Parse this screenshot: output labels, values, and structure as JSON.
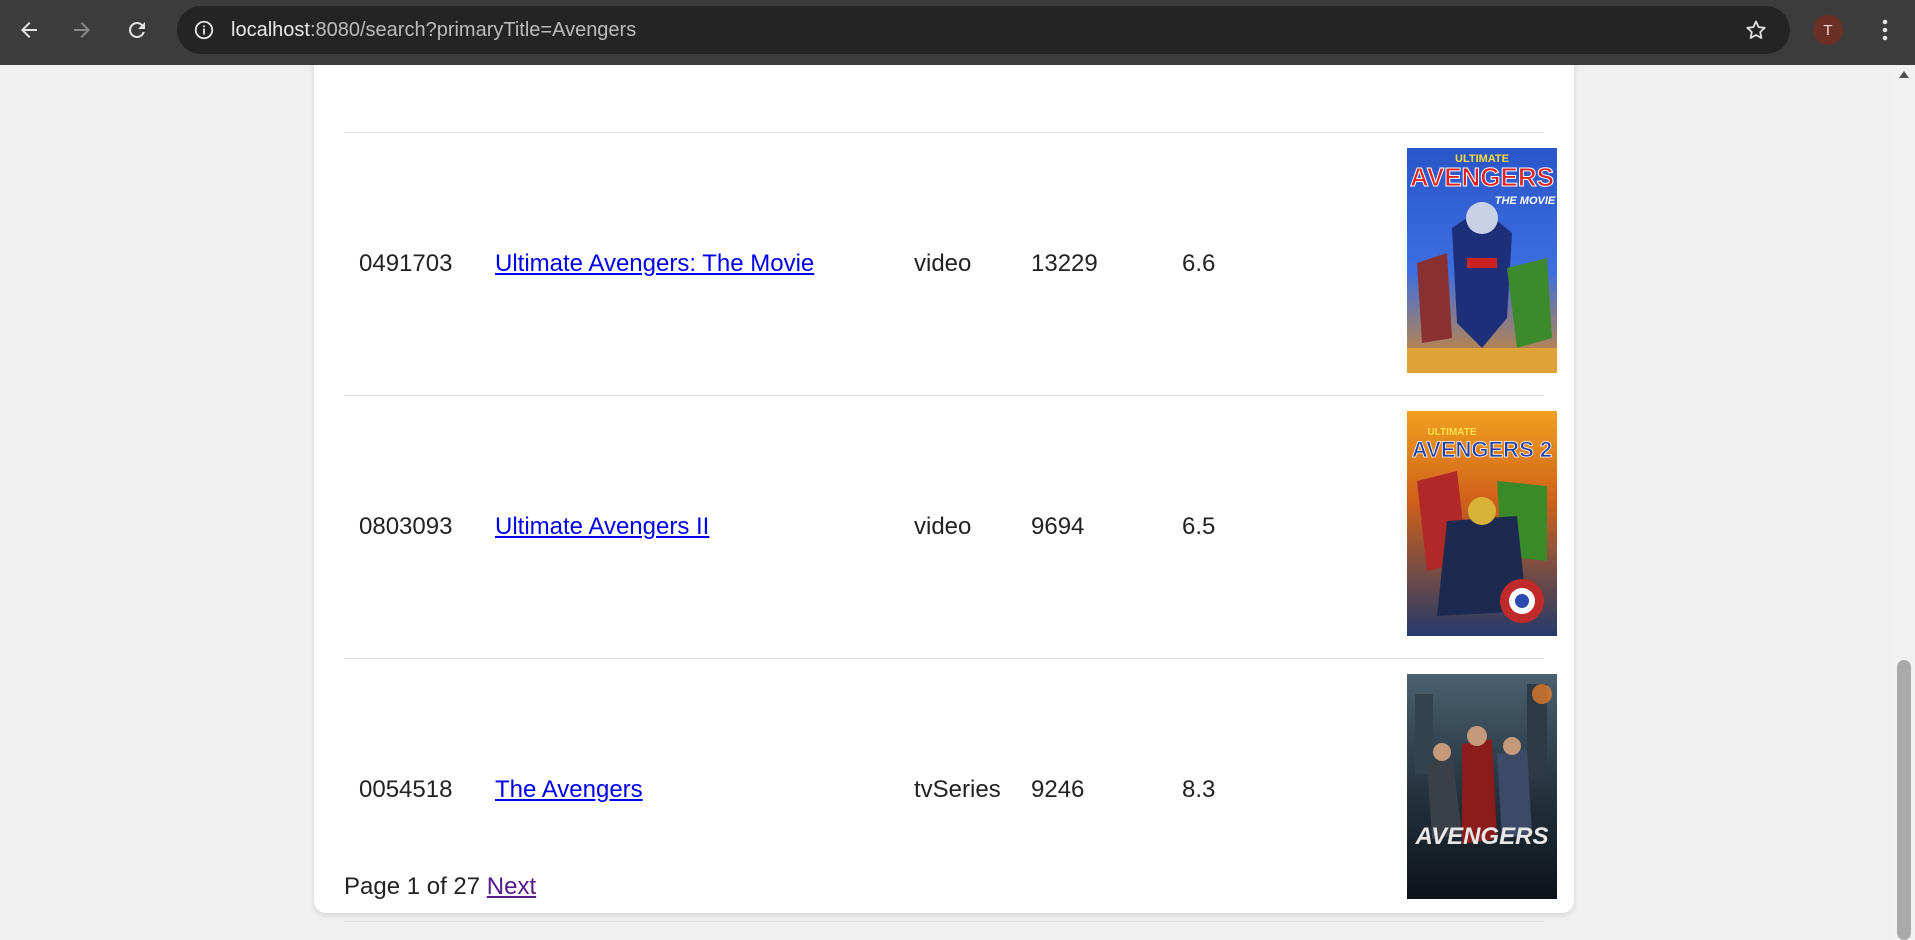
{
  "browser": {
    "url_host": "localhost",
    "url_rest": ":8080/search?primaryTitle=Avengers",
    "profile_initial": "T"
  },
  "results": [
    {
      "id": "0491703",
      "title": "Ultimate Avengers: The Movie",
      "type": "video",
      "votes": "13229",
      "rating": "6.6",
      "poster_text": [
        "ULTIMATE",
        "AVENGERS",
        "THE MOVIE"
      ]
    },
    {
      "id": "0803093",
      "title": "Ultimate Avengers II",
      "type": "video",
      "votes": "9694",
      "rating": "6.5",
      "poster_text": [
        "ULTIMATE",
        "AVENGERS 2"
      ]
    },
    {
      "id": "0054518",
      "title": "The Avengers",
      "type": "tvSeries",
      "votes": "9246",
      "rating": "8.3",
      "poster_text": [
        "AVENGERS"
      ]
    }
  ],
  "pager": {
    "status": "Page 1 of 27",
    "next_label": "Next"
  },
  "colors": {
    "chrome_bg": "#3c3c3c",
    "omnibox_bg": "#242424",
    "link": "#0000ee",
    "visited_link": "#551a8b",
    "avatar_bg": "#6b2f25"
  }
}
